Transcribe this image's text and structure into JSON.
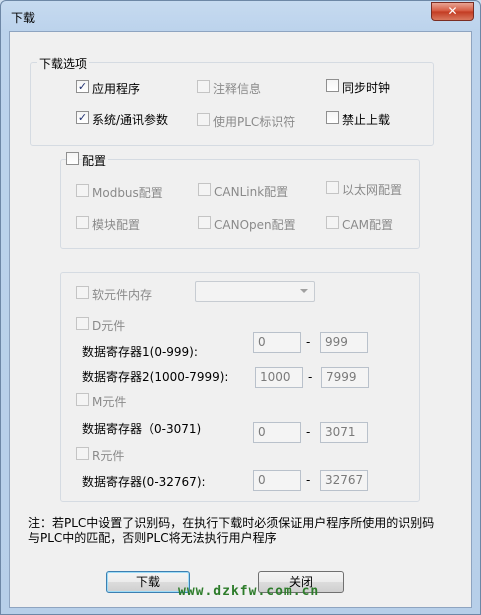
{
  "window": {
    "title": "下载",
    "close_glyph": "✕"
  },
  "download_options": {
    "title": "下载选项",
    "items": [
      {
        "label": "应用程序",
        "checked": true,
        "enabled": true
      },
      {
        "label": "注释信息",
        "checked": false,
        "enabled": false
      },
      {
        "label": "同步时钟",
        "checked": false,
        "enabled": true
      },
      {
        "label": "系统/通讯参数",
        "checked": true,
        "enabled": true
      },
      {
        "label": "使用PLC标识符",
        "checked": false,
        "enabled": false
      },
      {
        "label": "禁止上载",
        "checked": false,
        "enabled": true
      }
    ]
  },
  "config": {
    "label": "配置",
    "checked": false,
    "items": [
      {
        "label": "Modbus配置"
      },
      {
        "label": "CANLink配置"
      },
      {
        "label": "以太网配置"
      },
      {
        "label": "模块配置"
      },
      {
        "label": "CANOpen配置"
      },
      {
        "label": "CAM配置"
      }
    ]
  },
  "soft_memory": {
    "label": "软元件内存",
    "combo_value": "",
    "d_label": "D元件",
    "d_reg1": {
      "label": "数据寄存器1(0-999):",
      "from": "0",
      "to": "999"
    },
    "d_reg2": {
      "label": "数据寄存器2(1000-7999):",
      "from": "1000",
      "to": "7999"
    },
    "m_label": "M元件",
    "m_reg": {
      "label": "数据寄存器（0-3071)",
      "from": "0",
      "to": "3071"
    },
    "r_label": "R元件",
    "r_reg": {
      "label": "数据寄存器(0-32767):",
      "from": "0",
      "to": "32767"
    },
    "dash": "-"
  },
  "note": "注：若PLC中设置了识别码，在执行下载时必须保证用户程序所使用的识别码与PLC中的匹配，否则PLC将无法执行用户程序",
  "buttons": {
    "download": "下载",
    "close": "关闭"
  },
  "watermark": "www.dzkfw.com.cn"
}
